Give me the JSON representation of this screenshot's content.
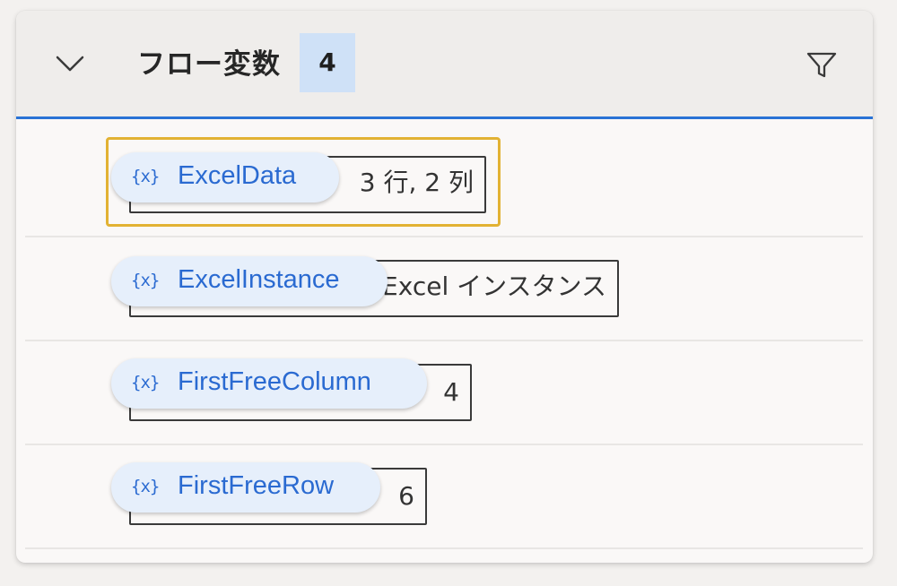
{
  "panel": {
    "title": "フロー変数",
    "count": "4",
    "collapse_icon": "chevron-down-icon",
    "filter_icon": "filter-icon",
    "accent_color": "#2a73d5",
    "selection_color": "#e2b233"
  },
  "variables": [
    {
      "icon": "{x}",
      "name": "ExcelData",
      "value": "3 行, 2 列",
      "selected": true
    },
    {
      "icon": "{x}",
      "name": "ExcelInstance",
      "value": "Excel インスタンス",
      "selected": false
    },
    {
      "icon": "{x}",
      "name": "FirstFreeColumn",
      "value": "4",
      "selected": false
    },
    {
      "icon": "{x}",
      "name": "FirstFreeRow",
      "value": "6",
      "selected": false
    }
  ]
}
